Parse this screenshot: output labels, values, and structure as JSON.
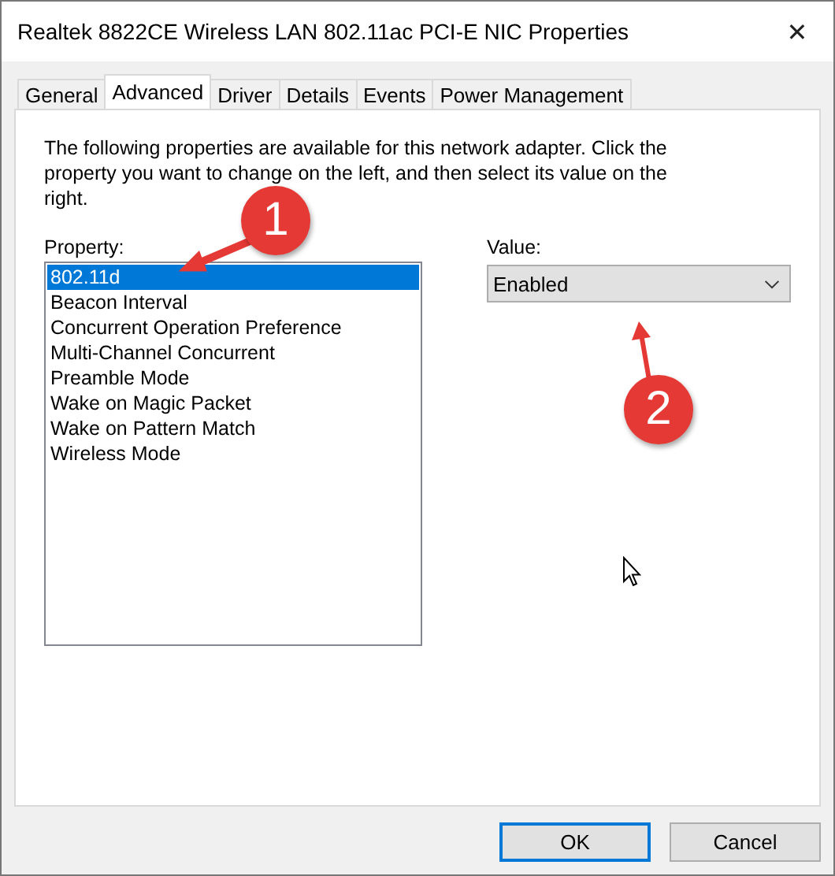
{
  "window": {
    "title": "Realtek 8822CE Wireless LAN 802.11ac PCI-E NIC Properties",
    "close": "✕"
  },
  "tabs": [
    {
      "label": "General",
      "selected": false
    },
    {
      "label": "Advanced",
      "selected": true
    },
    {
      "label": "Driver",
      "selected": false
    },
    {
      "label": "Details",
      "selected": false
    },
    {
      "label": "Events",
      "selected": false
    },
    {
      "label": "Power Management",
      "selected": false
    }
  ],
  "description": "The following properties are available for this network adapter. Click the property you want to change on the left, and then select its value on the right.",
  "property": {
    "label": "Property:",
    "items": [
      {
        "label": "802.11d",
        "selected": true
      },
      {
        "label": "Beacon Interval",
        "selected": false
      },
      {
        "label": "Concurrent Operation Preference",
        "selected": false
      },
      {
        "label": "Multi-Channel Concurrent",
        "selected": false
      },
      {
        "label": "Preamble Mode",
        "selected": false
      },
      {
        "label": "Wake on Magic Packet",
        "selected": false
      },
      {
        "label": "Wake on Pattern Match",
        "selected": false
      },
      {
        "label": "Wireless Mode",
        "selected": false
      }
    ]
  },
  "value": {
    "label": "Value:",
    "selected": "Enabled"
  },
  "annotations": [
    "1",
    "2"
  ],
  "buttons": [
    {
      "label": "OK",
      "default": true
    },
    {
      "label": "Cancel",
      "default": false
    }
  ]
}
